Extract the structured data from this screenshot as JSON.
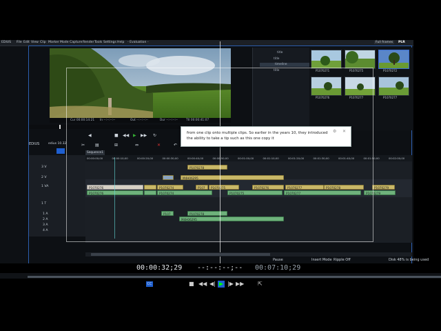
{
  "menu": {
    "app": "EDIUS",
    "items": [
      "File",
      "Edit",
      "View",
      "Clip",
      "Marker",
      "Mode",
      "Capture",
      "Render",
      "Tools",
      "Settings",
      "Help"
    ],
    "evaluation": "- Evaluation -",
    "frames_select": "Full frames",
    "plr_badge": "PLR"
  },
  "player": {
    "tc_in": "Cur 00:00:14:21",
    "tc_mid": "In --:--:--:--",
    "tc_out": "Out --:--:--:--",
    "tc_dur": "Dur --:--:--:--",
    "tc_ttl": "Ttl 00:00:41:07"
  },
  "bin": {
    "folders": [
      "title",
      "title",
      "timeline",
      "title"
    ]
  },
  "thumbnails": [
    {
      "label": "P1070271"
    },
    {
      "label": "P1070275"
    },
    {
      "label": "P1070272"
    },
    {
      "label": "P1070276"
    },
    {
      "label": "P1070277"
    },
    {
      "label": "P1070277"
    }
  ],
  "timeline": {
    "project": "EDIUS",
    "project2": "edius 10.32",
    "sequence_tab": "Sequence1",
    "tracks": [
      "3 V",
      "2 V",
      "1 VA",
      "1 T",
      "1 A",
      "2 A",
      "3 A",
      "4 A"
    ],
    "ruler": [
      "00:00:00;00",
      "00:00:10;00",
      "00:00:20;00",
      "00:00:30;00",
      "00:00:40;00",
      "00:00:50;00",
      "00:01:00;00",
      "00:01:10;00",
      "00:01:20;00",
      "00:01:30;00",
      "00:01:40;00",
      "00:01:50;00",
      "00:02:00;00"
    ],
    "clips_v3": [
      "P1070278"
    ],
    "clips_v2": [
      "M4H06295"
    ],
    "clips_va": [
      "P1070276",
      "P1070274",
      "P107",
      "P1070275",
      "P1070276",
      "P1070277",
      "P1070278",
      "P1070279"
    ],
    "clips_a": [
      "P1070276",
      "P1070274",
      "P1070275",
      "P1070277",
      "P1070279"
    ],
    "clips_a1": [
      "P107",
      "P1070278"
    ],
    "clips_a2": [
      "M4H06295"
    ],
    "status_pause": "Pause",
    "status_insert": "Insert Mode",
    "status_ripple": "Ripple Off",
    "status_disk": "Disk 48% is being used"
  },
  "tooltip": {
    "text": "from one clip onto multiple clips. So earlier in the years 10, they introduced the ability to take a tip such as this one copy it"
  },
  "timecodes": {
    "current": "00:00:32;29",
    "in_out": "--:--:--;--",
    "duration": "00:07:10;29"
  }
}
